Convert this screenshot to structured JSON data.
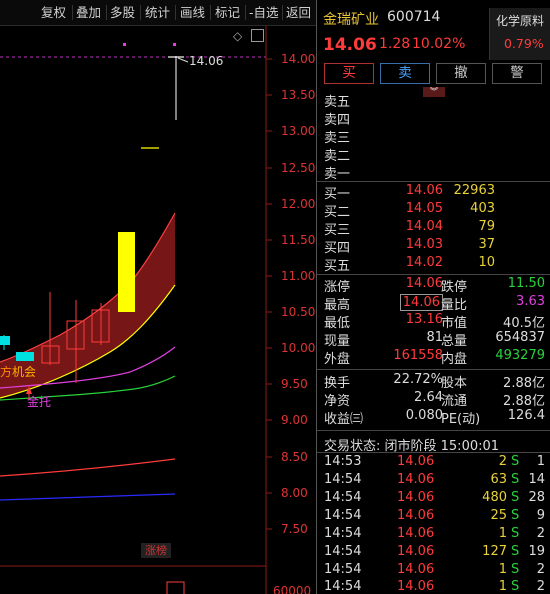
{
  "toolbar": [
    "复权",
    "叠加",
    "多股",
    "统计",
    "画线",
    "标记",
    "-自选",
    "返回"
  ],
  "chart": {
    "price_axis": [
      "14.00",
      "13.50",
      "13.00",
      "12.50",
      "12.00",
      "11.50",
      "11.00",
      "10.50",
      "10.00",
      "9.50",
      "9.00",
      "8.50",
      "8.00",
      "7.50"
    ],
    "high_marker": "14.06",
    "signal_labels": [
      "机会",
      "金托"
    ],
    "zhangbang_label": "涨榜",
    "volume_label": "60000",
    "colors": {
      "up": "#ff3b3b",
      "limit_up": "#ffff00",
      "band": "#8b1a1a",
      "ma1": "#e040e0",
      "ma2": "#28d23a",
      "ma3": "#ff3b3b",
      "ma4": "#2a2aff"
    }
  },
  "quote": {
    "name": "金瑞矿业",
    "code": "600714",
    "price": "14.06",
    "change": "1.28",
    "change_pct": "10.02%",
    "sector_name": "化学原料",
    "sector_pct": "0.79%",
    "actions": {
      "buy": "买",
      "sell": "卖",
      "cancel": "撤",
      "alert": "警"
    }
  },
  "asks": [
    {
      "label": "卖五",
      "price": "",
      "vol": ""
    },
    {
      "label": "卖四",
      "price": "",
      "vol": ""
    },
    {
      "label": "卖三",
      "price": "",
      "vol": ""
    },
    {
      "label": "卖二",
      "price": "",
      "vol": ""
    },
    {
      "label": "卖一",
      "price": "",
      "vol": ""
    }
  ],
  "bids": [
    {
      "label": "买一",
      "price": "14.06",
      "vol": "22963"
    },
    {
      "label": "买二",
      "price": "14.05",
      "vol": "403"
    },
    {
      "label": "买三",
      "price": "14.04",
      "vol": "79"
    },
    {
      "label": "买四",
      "price": "14.03",
      "vol": "37"
    },
    {
      "label": "买五",
      "price": "14.02",
      "vol": "10"
    }
  ],
  "stats1": {
    "limit_up_label": "涨停",
    "limit_up": "14.06",
    "limit_down_label": "跌停",
    "limit_down": "11.50",
    "high_label": "最高",
    "high": "14.06",
    "vol_ratio_label": "量比",
    "vol_ratio": "3.63",
    "low_label": "最低",
    "low": "13.16",
    "mktcap_label": "市值",
    "mktcap": "40.5亿",
    "cur_vol_label": "现量",
    "cur_vol": "81",
    "total_vol_label": "总量",
    "total_vol": "654837",
    "outer_label": "外盘",
    "outer": "161558",
    "inner_label": "内盘",
    "inner": "493279"
  },
  "stats2": {
    "turnover_label": "换手",
    "turnover": "22.72%",
    "shares_label": "股本",
    "shares": "2.88亿",
    "nav_label": "净资",
    "nav": "2.64",
    "float_label": "流通",
    "float": "2.88亿",
    "eps_label": "收益㈢",
    "eps": "0.080",
    "pe_label": "PE(动)",
    "pe": "126.4"
  },
  "status": "交易状态: 闭市阶段 15:00:01",
  "ticks": [
    {
      "time": "14:53",
      "price": "14.06",
      "qty": "2",
      "dir": "S",
      "n": "1"
    },
    {
      "time": "14:54",
      "price": "14.06",
      "qty": "63",
      "dir": "S",
      "n": "14"
    },
    {
      "time": "14:54",
      "price": "14.06",
      "qty": "480",
      "dir": "S",
      "n": "28"
    },
    {
      "time": "14:54",
      "price": "14.06",
      "qty": "25",
      "dir": "S",
      "n": "9"
    },
    {
      "time": "14:54",
      "price": "14.06",
      "qty": "1",
      "dir": "S",
      "n": "2"
    },
    {
      "time": "14:54",
      "price": "14.06",
      "qty": "127",
      "dir": "S",
      "n": "19"
    },
    {
      "time": "14:54",
      "price": "14.06",
      "qty": "1",
      "dir": "S",
      "n": "2"
    },
    {
      "time": "14:54",
      "price": "14.06",
      "qty": "1",
      "dir": "S",
      "n": "2"
    }
  ]
}
